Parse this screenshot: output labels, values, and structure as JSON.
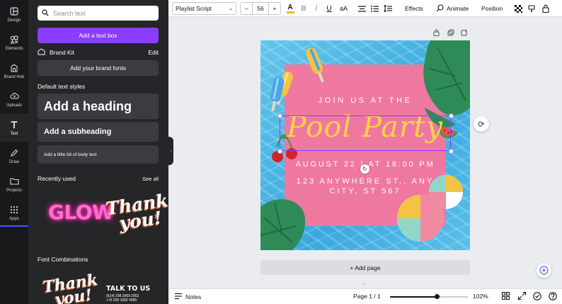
{
  "rail": {
    "items": [
      {
        "label": "Design",
        "icon": "layout-icon"
      },
      {
        "label": "Elements",
        "icon": "shapes-icon"
      },
      {
        "label": "Brand Hub",
        "icon": "brand-hub-icon"
      },
      {
        "label": "Uploads",
        "icon": "cloud-upload-icon"
      },
      {
        "label": "Text",
        "icon": "text-t-icon"
      },
      {
        "label": "Draw",
        "icon": "pen-icon"
      },
      {
        "label": "Projects",
        "icon": "folder-icon"
      },
      {
        "label": "Apps",
        "icon": "grid-icon"
      }
    ],
    "active": "Text"
  },
  "panel": {
    "search_placeholder": "Search text",
    "add_textbox": "Add a text box",
    "brand_kit": "Brand Kit",
    "brand_kit_edit": "Edit",
    "add_brand_fonts": "Add your brand fonts",
    "default_styles": "Default text styles",
    "heading": "Add a heading",
    "subheading": "Add a subheading",
    "body": "Add a little bit of body text",
    "recently_used": "Recently used",
    "see_all": "See all",
    "recent_1": "GLOW",
    "recent_2_line1": "Thank",
    "recent_2_line2": "you!",
    "font_combinations": "Font Combinations",
    "combo_1_line1": "Thank",
    "combo_1_line2": "you!",
    "combo_2_title": "TALK TO US",
    "combo_2_line1": "(614) 298 3069 2052",
    "combo_2_line2": "+76 209 1082 4085"
  },
  "toolbar": {
    "font": "Playlist Script",
    "size_minus": "–",
    "size": "56",
    "size_plus": "+",
    "effects": "Effects",
    "animate": "Animate",
    "position": "Position",
    "text_color": "#f5b800"
  },
  "design": {
    "join": "JOIN US AT THE",
    "title": "Pool Party",
    "date": "AUGUST 22 | AT 18:00 PM",
    "address": "123 ANYWHERE ST., ANY CITY, ST 567",
    "pink": "#ef78a1",
    "title_color": "#ffd24a"
  },
  "canvas": {
    "add_page": "+ Add page"
  },
  "bottom": {
    "notes": "Notes",
    "page": "Page 1 / 1",
    "zoom": "102%",
    "zoom_fraction": 0.6
  }
}
